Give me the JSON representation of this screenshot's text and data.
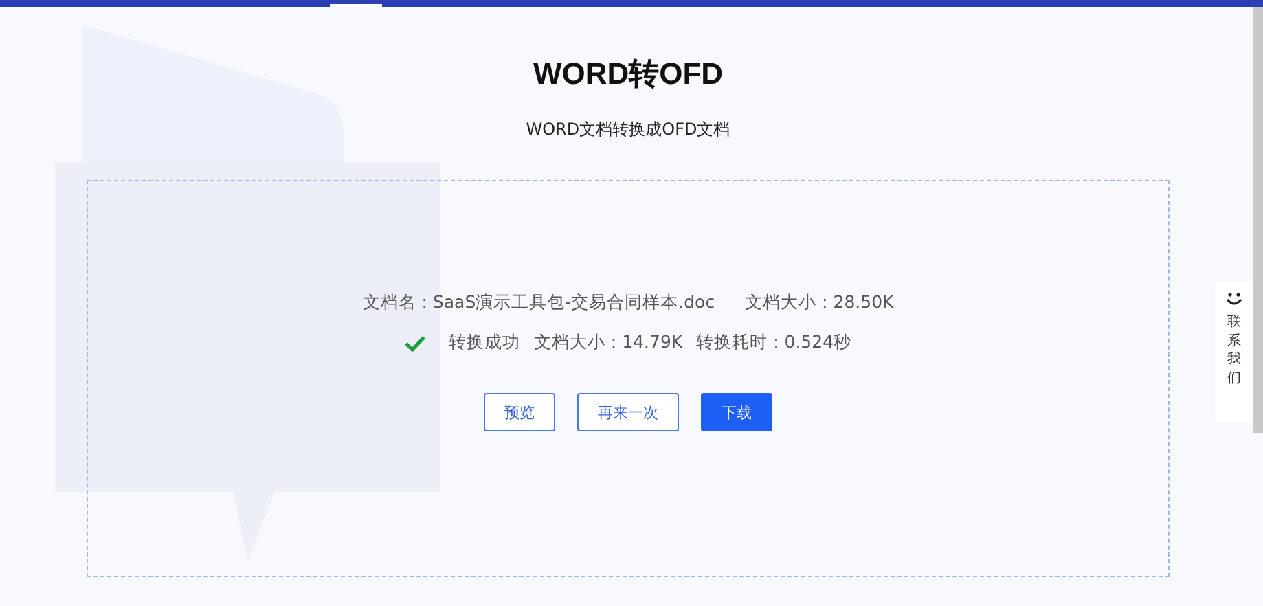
{
  "title": "WORD转OFD",
  "subtitle": "WORD文档转换成OFD文档",
  "source": {
    "name": "文档名 : SaaS演示工具包-交易合同样本.doc",
    "size": "文档大小 : 28.50K"
  },
  "result": {
    "status": "转换成功",
    "success": true,
    "size": "文档大小 : 14.79K",
    "time": "转换耗时 : 0.524秒"
  },
  "buttons": [
    {
      "label": "预览",
      "kind": "outline"
    },
    {
      "label": "再来一次",
      "kind": "outline"
    },
    {
      "label": "下载",
      "kind": "primary"
    }
  ],
  "contact": {
    "label": "联系我们"
  }
}
